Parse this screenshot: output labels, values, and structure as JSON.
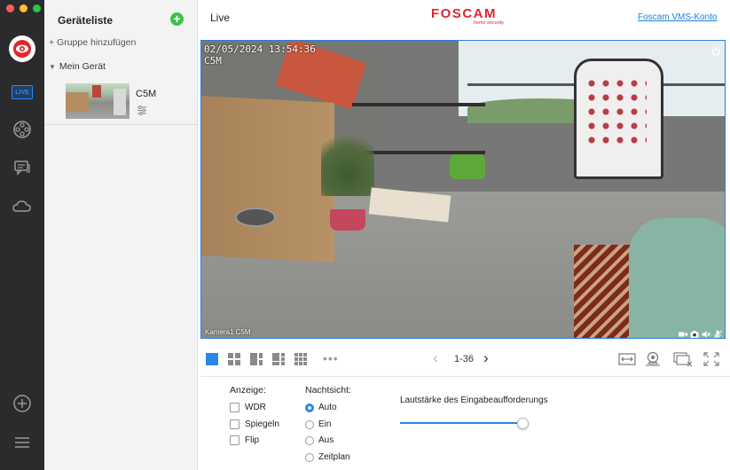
{
  "sidebar": {
    "items": [
      {
        "name": "logo",
        "icon": "foscam-eye-icon"
      },
      {
        "name": "live",
        "icon": "live-tv-icon",
        "label": "LIVE"
      },
      {
        "name": "playback",
        "icon": "film-reel-icon"
      },
      {
        "name": "messages",
        "icon": "chat-icon"
      },
      {
        "name": "cloud",
        "icon": "cloud-icon"
      }
    ],
    "bottom": [
      {
        "name": "add",
        "icon": "plus-circle-icon"
      },
      {
        "name": "menu",
        "icon": "menu-icon"
      }
    ]
  },
  "device_panel": {
    "title": "Geräteliste",
    "add_group": "+ Gruppe hinzufügen",
    "group_name": "Mein Gerät",
    "devices": [
      {
        "name": "C5M"
      }
    ]
  },
  "header": {
    "title": "Live",
    "brand": "FOSCAM",
    "brand_tagline": "home security",
    "vms_link": "Foscam VMS-Konto"
  },
  "video": {
    "timestamp": "02/05/2024 13:54:36",
    "osd_name": "C5M",
    "camera_label": "Kamera1 C5M"
  },
  "toolbar": {
    "more": "•••",
    "pager_prev": "‹",
    "pager_range": "1-36",
    "pager_next": "›"
  },
  "settings": {
    "display_label": "Anzeige:",
    "display_options": [
      {
        "label": "WDR",
        "checked": false
      },
      {
        "label": "Spiegeln",
        "checked": false
      },
      {
        "label": "Flip",
        "checked": false
      }
    ],
    "night_label": "Nachtsicht:",
    "night_options": [
      {
        "label": "Auto",
        "selected": true
      },
      {
        "label": "Ein",
        "selected": false
      },
      {
        "label": "Aus",
        "selected": false
      },
      {
        "label": "Zeitplan",
        "selected": false
      }
    ],
    "volume_label": "Lautstärke des Eingabeaufforderungs",
    "volume_level": 1.0
  },
  "colors": {
    "accent": "#2a86e8",
    "brand_red": "#e0262e",
    "rail_bg": "#2b2b2d",
    "add_green": "#3ec24a"
  }
}
